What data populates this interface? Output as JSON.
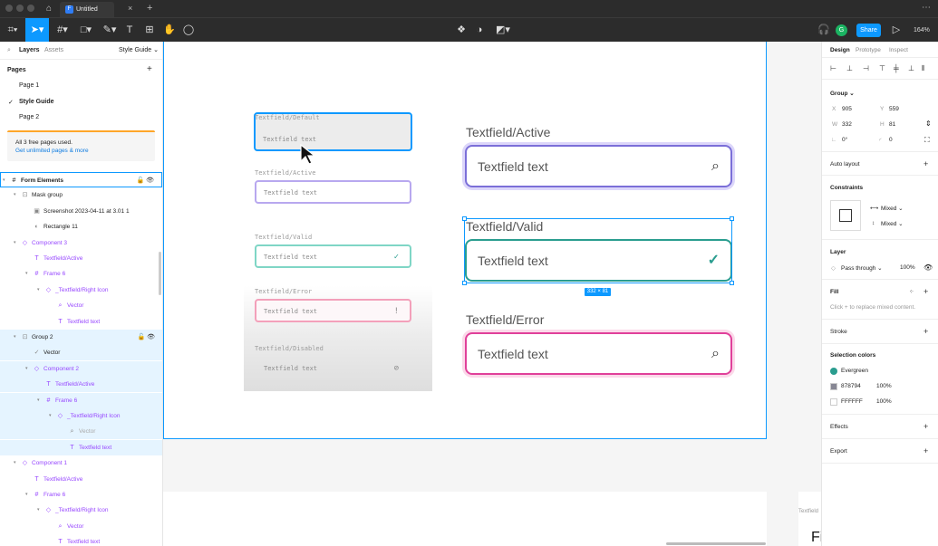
{
  "window": {
    "tab_title": "Untitled",
    "tab_icon_label": "F",
    "tab_close": "×",
    "tab_add": "+",
    "more": "⋯"
  },
  "toolbar": {
    "share_label": "Share",
    "avatar_initial": "G",
    "zoom_label": "164%",
    "play_icon": "▷"
  },
  "left_panel": {
    "tabs": {
      "layers": "Layers",
      "assets": "Assets",
      "page_dropdown": "Style Guide ⌄"
    },
    "pages_title": "Pages",
    "pages_add": "+",
    "pages": [
      {
        "label": "Page 1",
        "selected": false
      },
      {
        "label": "Style Guide",
        "selected": true
      },
      {
        "label": "Page 2",
        "selected": false
      }
    ],
    "upgrade": {
      "line1": "All 3 free pages used.",
      "link": "Get unlimited pages & more"
    },
    "layers": [
      {
        "label": "Form Elements",
        "icon": "#",
        "indent": 0,
        "style": "bold",
        "state": "frame",
        "caret": "▾"
      },
      {
        "label": "Mask group",
        "icon": "⊡",
        "indent": 1,
        "style": "normal",
        "state": "",
        "caret": "▾"
      },
      {
        "label": "Screenshot 2023-04-11 at 3.01 1",
        "icon": "▣",
        "indent": 2,
        "style": "normal",
        "state": "",
        "caret": ""
      },
      {
        "label": "Rectangle 11",
        "icon": "◐",
        "indent": 2,
        "style": "normal",
        "state": "",
        "caret": ""
      },
      {
        "label": "Component 3",
        "icon": "◇",
        "indent": 1,
        "style": "purple",
        "state": "",
        "caret": "▾"
      },
      {
        "label": "Textfield/Active",
        "icon": "T",
        "indent": 2,
        "style": "purple",
        "state": "",
        "caret": ""
      },
      {
        "label": "Frame 6",
        "icon": "#",
        "indent": 2,
        "style": "purple",
        "state": "",
        "caret": "▾"
      },
      {
        "label": "_Textfield/Right Icon",
        "icon": "◇",
        "indent": 3,
        "style": "purple",
        "state": "",
        "caret": "▾"
      },
      {
        "label": "Vector",
        "icon": "⌕",
        "indent": 4,
        "style": "purple",
        "state": "",
        "caret": ""
      },
      {
        "label": "Textfield text",
        "icon": "T",
        "indent": 4,
        "style": "purple",
        "state": "",
        "caret": ""
      },
      {
        "label": "Group 2",
        "icon": "⊡",
        "indent": 1,
        "style": "normal",
        "state": "sel",
        "caret": "▾"
      },
      {
        "label": "Vector",
        "icon": "✓",
        "indent": 2,
        "style": "normal",
        "state": "sel",
        "caret": ""
      },
      {
        "label": "Component 2",
        "icon": "◇",
        "indent": 2,
        "style": "purple",
        "state": "sel",
        "caret": "▾"
      },
      {
        "label": "Textfield/Active",
        "icon": "T",
        "indent": 3,
        "style": "purple",
        "state": "sel",
        "caret": ""
      },
      {
        "label": "Frame 6",
        "icon": "#",
        "indent": 3,
        "style": "purple",
        "state": "sel",
        "caret": "▾"
      },
      {
        "label": "_Textfield/Right Icon",
        "icon": "◇",
        "indent": 4,
        "style": "purple",
        "state": "sel",
        "caret": "▾"
      },
      {
        "label": "Vector",
        "icon": "⌕",
        "indent": 5,
        "style": "muted",
        "state": "sel",
        "caret": ""
      },
      {
        "label": "Textfield text",
        "icon": "T",
        "indent": 5,
        "style": "purple",
        "state": "sel",
        "caret": ""
      },
      {
        "label": "Component 1",
        "icon": "◇",
        "indent": 1,
        "style": "purple",
        "state": "",
        "caret": "▾"
      },
      {
        "label": "Textfield/Active",
        "icon": "T",
        "indent": 2,
        "style": "purple",
        "state": "",
        "caret": ""
      },
      {
        "label": "Frame 6",
        "icon": "#",
        "indent": 2,
        "style": "purple",
        "state": "",
        "caret": "▾"
      },
      {
        "label": "_Textfield/Right Icon",
        "icon": "◇",
        "indent": 3,
        "style": "purple",
        "state": "",
        "caret": "▾"
      },
      {
        "label": "Vector",
        "icon": "⌕",
        "indent": 4,
        "style": "purple",
        "state": "",
        "caret": ""
      },
      {
        "label": "Textfield text",
        "icon": "T",
        "indent": 4,
        "style": "purple",
        "state": "",
        "caret": ""
      }
    ],
    "layer_actions": "🔓 👁"
  },
  "canvas": {
    "screenshot_fields": [
      {
        "label": "Textfield/Default",
        "text": "Textfield text",
        "icon": "",
        "state": "default"
      },
      {
        "label": "Textfield/Active",
        "text": "Textfield text",
        "icon": "",
        "state": "active"
      },
      {
        "label": "Textfield/Valid",
        "text": "Textfield text",
        "icon": "✓",
        "state": "valid"
      },
      {
        "label": "Textfield/Error",
        "text": "Textfield text",
        "icon": "!",
        "state": "error"
      },
      {
        "label": "Textfield/Disabled",
        "text": "Textfield text",
        "icon": "⊘",
        "state": "disabled"
      }
    ],
    "big_fields": [
      {
        "label": "Textfield/Active",
        "text": "Textfield text",
        "icon": "⌕",
        "state": "active"
      },
      {
        "label": "Textfield/Valid",
        "text": "Textfield text",
        "icon": "✓",
        "state": "valid"
      },
      {
        "label": "Textfield/Error",
        "text": "Textfield text",
        "icon": "⌕",
        "state": "error"
      }
    ],
    "selection_size": "332 × 81",
    "peek_label": "Textfield",
    "peek_text": "Fi",
    "help_label": "?"
  },
  "right_panel": {
    "tabs": [
      "Design",
      "Prototype",
      "Inspect"
    ],
    "group_title": "Group ⌄",
    "x_label": "X",
    "x_value": "905",
    "y_label": "Y",
    "y_value": "559",
    "w_label": "W",
    "w_value": "332",
    "h_label": "H",
    "h_value": "81",
    "rotation": "0°",
    "radius": "0",
    "auto_layout": "Auto layout",
    "constraints": "Constraints",
    "constraint_h": "Mixed ⌄",
    "constraint_v": "Mixed ⌄",
    "layer_title": "Layer",
    "blend_mode": "Pass through ⌄",
    "layer_opacity": "100%",
    "fill_title": "Fill",
    "fill_hint": "Click + to replace mixed content.",
    "stroke_title": "Stroke",
    "selection_colors_title": "Selection colors",
    "selection_colors": [
      {
        "name": "Evergreen",
        "opacity": "",
        "color": "#2a9d8f",
        "shape": "circle"
      },
      {
        "name": "878794",
        "opacity": "100%",
        "color": "#878794",
        "shape": "square"
      },
      {
        "name": "FFFFFF",
        "opacity": "100%",
        "color": "#ffffff",
        "shape": "square"
      }
    ],
    "effects_title": "Effects",
    "export_title": "Export"
  },
  "colors": {
    "accent": "#0d99ff",
    "active_border": "#7b6fd8",
    "valid_border": "#2a9d8f",
    "error_border": "#e0409a",
    "component_purple": "#9747ff"
  }
}
